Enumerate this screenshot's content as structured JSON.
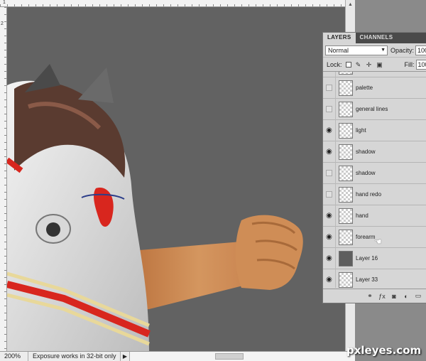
{
  "ruler": {
    "top_label": "1",
    "left_label": "2"
  },
  "status": {
    "zoom": "200%",
    "message": "Exposure works in 32-bit only"
  },
  "panel": {
    "tabs": [
      "LAYERS",
      "CHANNELS"
    ],
    "blend_mode": "Normal",
    "opacity_label": "Opacity:",
    "opacity_value": "100%",
    "lock_label": "Lock:",
    "fill_label": "Fill:",
    "fill_value": "100%",
    "layers": [
      {
        "name": "palette",
        "visible": false,
        "thumb": "transparent"
      },
      {
        "name": "general lines",
        "visible": false,
        "thumb": "transparent"
      },
      {
        "name": "light",
        "visible": true,
        "thumb": "transparent"
      },
      {
        "name": "shadow",
        "visible": true,
        "thumb": "transparent"
      },
      {
        "name": "shadow",
        "visible": false,
        "thumb": "transparent"
      },
      {
        "name": "hand redo",
        "visible": false,
        "thumb": "transparent"
      },
      {
        "name": "hand",
        "visible": true,
        "thumb": "transparent"
      },
      {
        "name": "forearm",
        "visible": true,
        "thumb": "transparent"
      },
      {
        "name": "Layer 16",
        "visible": true,
        "thumb": "solid"
      },
      {
        "name": "Layer 33",
        "visible": true,
        "thumb": "transparent"
      }
    ]
  },
  "watermark": "pxleyes.com",
  "colors": {
    "canvas": "#626262",
    "panel": "#d6d6d6",
    "tab_bar": "#4a4a4a"
  }
}
